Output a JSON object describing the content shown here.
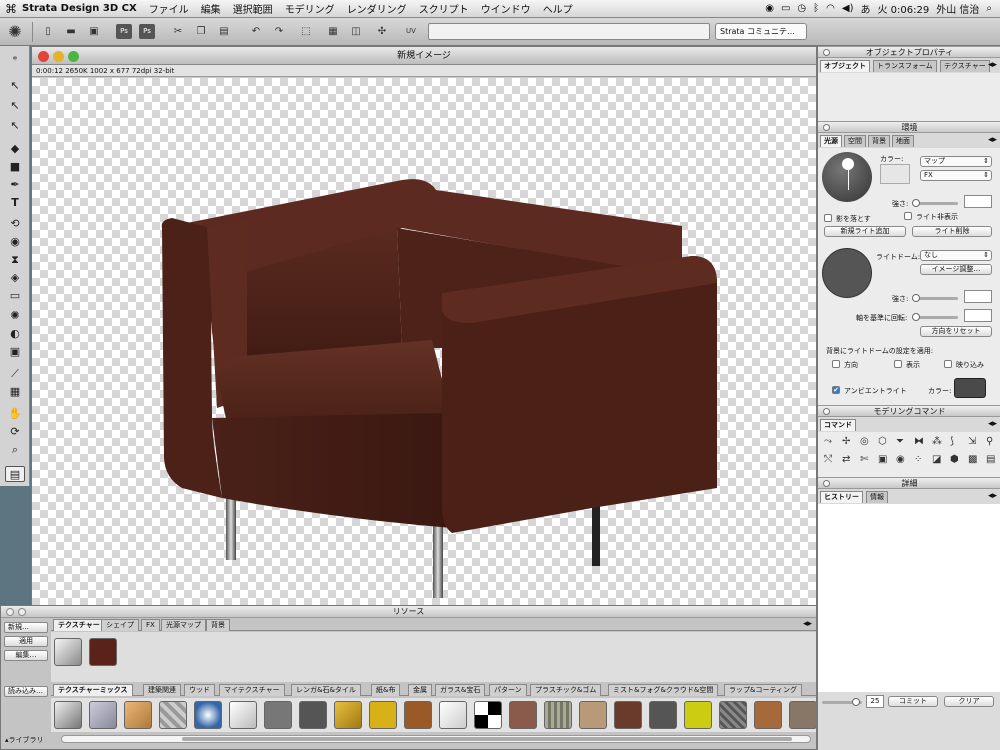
{
  "menubar": {
    "apple_icon": "apple-icon",
    "app_name": "Strata Design 3D CX",
    "menus": [
      "ファイル",
      "編集",
      "選択範囲",
      "モデリング",
      "レンダリング",
      "スクリプト",
      "ウインドウ",
      "ヘルプ"
    ],
    "input_indicator": "あ",
    "clock": "火 0:06:29",
    "user": "外山 信治"
  },
  "toolbar": {
    "community_label": "Strata コミュニテ…"
  },
  "document": {
    "title": "新規イメージ",
    "status": "0:00:12  2650K  1002 x 677  72dpi  32-bit"
  },
  "resources": {
    "title": "リソース",
    "buttons": [
      "新規…",
      "適用",
      "編集…",
      "読み込み…"
    ],
    "library_label": "ライブラリ",
    "tabs": [
      "テクスチャー",
      "シェイプ",
      "FX",
      "光源マップ",
      "背景"
    ],
    "category_tabs": [
      "テクスチャーミックス",
      "建築関連",
      "ウッド",
      "マイテクスチャー",
      "レンガ&石&タイル",
      "紙&布",
      "金属",
      "ガラス&宝石",
      "パターン",
      "プラスチック&ゴム",
      "ミスト&フォグ&クラウド&空間",
      "ラップ&コーティング"
    ]
  },
  "object_props": {
    "title": "オブジェクトプロパティ",
    "tabs": [
      "オブジェクト",
      "トランスフォーム",
      "テクスチャー"
    ]
  },
  "environment": {
    "title": "環境",
    "tabs": [
      "光源",
      "空間",
      "背景",
      "地面"
    ],
    "color_label": "カラー:",
    "map_select": "マップ",
    "fx_select": "FX",
    "strength_label": "強さ:",
    "cast_shadow": "影を落とす",
    "hide_light": "ライト非表示",
    "add_light": "新規ライト追加",
    "delete_light": "ライト削除",
    "light_dome_label": "ライトドーム:",
    "light_dome_value": "なし",
    "image_adjust": "イメージ調整…",
    "strength_label2": "強さ:",
    "rotate_label": "軸を基準に回転:",
    "reset_direction": "方向をリセット",
    "apply_dome_label": "背景にライトドームの設定を適用:",
    "dir_label": "方向",
    "show_label": "表示",
    "reflect_label": "映り込み",
    "ambient_label": "アンビエントライト",
    "ambient_checked": "✔",
    "ambient_color_label": "カラー:"
  },
  "modeling": {
    "title": "モデリングコマンド",
    "tab": "コマンド"
  },
  "details": {
    "title": "詳細",
    "tabs": [
      "ヒストリー",
      "情報"
    ],
    "history_value": "25",
    "commit": "コミット",
    "clear": "クリア"
  },
  "colors": {
    "sofa": "#4a2118",
    "sofa_light": "#5e2b20",
    "accent_blue": "#3a78c8"
  }
}
